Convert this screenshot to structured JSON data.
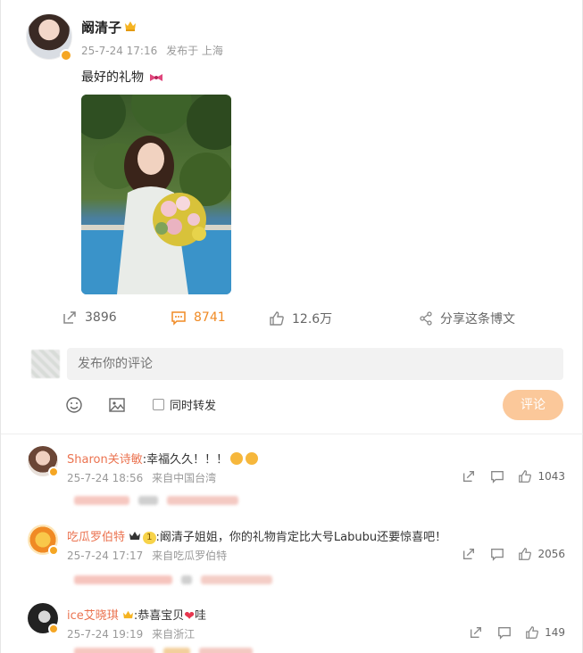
{
  "post": {
    "author": "阚清子",
    "time": "25-7-24 17:16",
    "location": "发布于 上海",
    "text": "最好的礼物"
  },
  "actions": {
    "repost_count": "3896",
    "comment_count": "8741",
    "like_count": "12.6万",
    "share_label": "分享这条博文"
  },
  "composer": {
    "placeholder": "发布你的评论",
    "also_repost_label": "同时转发",
    "submit_label": "评论"
  },
  "comments": [
    {
      "name": "Sharon关诗敏",
      "text": ":幸福久久！！！",
      "time": "25-7-24 18:56",
      "location": "来自中国台湾",
      "likes": "1043"
    },
    {
      "name": "吃瓜罗伯特",
      "level": "1",
      "text": ":阚清子姐姐，你的礼物肯定比大号Labubu还要惊喜吧！",
      "time": "25-7-24 17:17",
      "location": "来自吃瓜罗伯特",
      "likes": "2056"
    },
    {
      "name": "ice艾晓琪",
      "text": ":恭喜宝贝",
      "text_suffix": "哇",
      "time": "25-7-24 19:19",
      "location": "来自浙江",
      "likes": "149"
    }
  ],
  "colors": {
    "accent_orange": "#eb7350",
    "active_comment": "#f08a24",
    "submit_disabled": "#fbc89a",
    "vip_badge": "#f5a623"
  }
}
